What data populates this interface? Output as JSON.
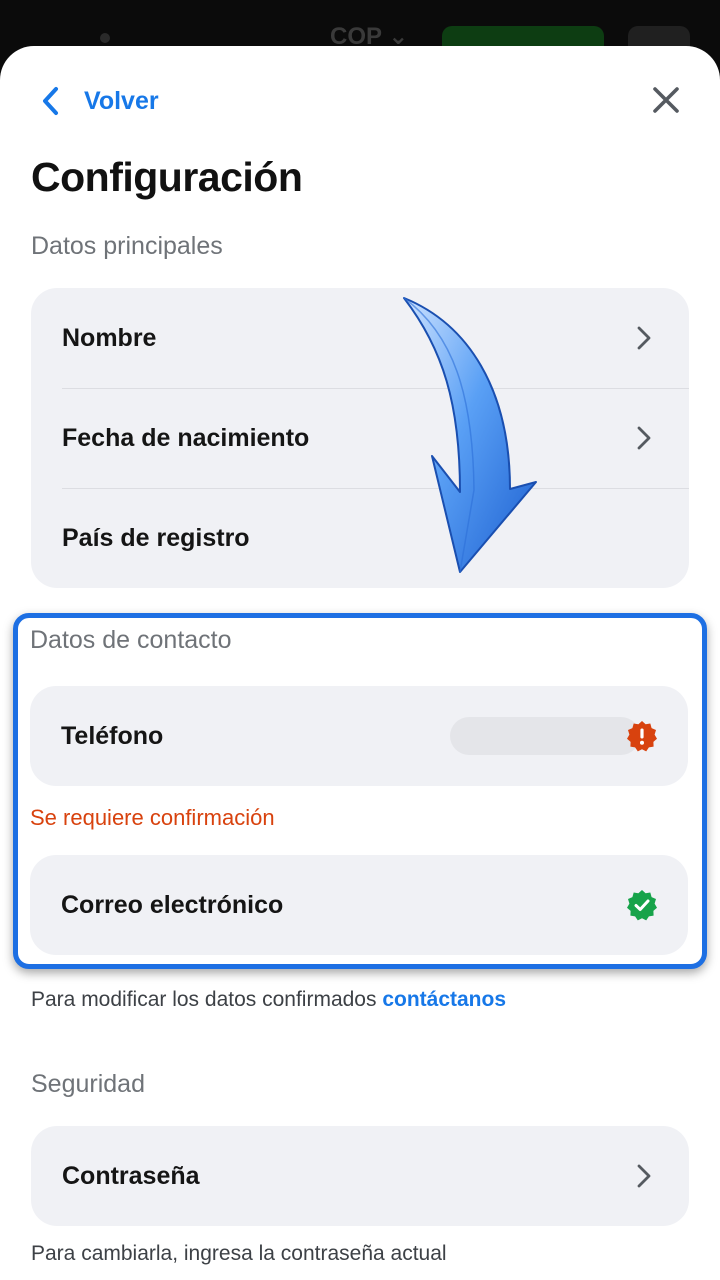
{
  "statusbar": {
    "currency": "COP ⌄"
  },
  "header": {
    "back_label": "Volver",
    "title": "Configuración"
  },
  "main_data": {
    "section_title": "Datos principales",
    "items": [
      {
        "label": "Nombre"
      },
      {
        "label": "Fecha de nacimiento"
      },
      {
        "label": "País de registro"
      }
    ]
  },
  "contact": {
    "section_title": "Datos de contacto",
    "phone_label": "Teléfono",
    "phone_error": "Se requiere confirmación",
    "email_label": "Correo electrónico",
    "note_text": "Para modificar los datos confirmados ",
    "note_link": "contáctanos"
  },
  "security": {
    "section_title": "Seguridad",
    "password_label": "Contraseña",
    "note_text": "Para cambiarla, ingresa la contraseña actual"
  },
  "colors": {
    "accent": "#1778e8",
    "error": "#d8420e",
    "success": "#17a34a",
    "highlight_border": "#1d6fe3"
  }
}
